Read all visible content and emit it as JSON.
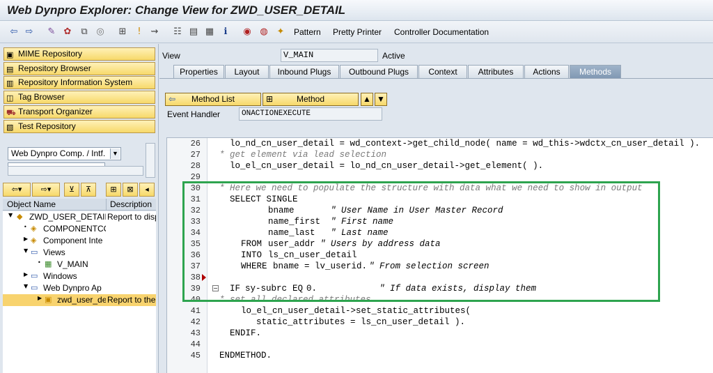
{
  "window": {
    "title": "Web Dynpro Explorer: Change View for ZWD_USER_DETAIL"
  },
  "toolbar": {
    "pattern": "Pattern",
    "pretty_printer": "Pretty Printer",
    "controller_documentation": "Controller Documentation"
  },
  "nav": {
    "mime_repository": "MIME Repository",
    "repository_browser": "Repository Browser",
    "repository_information_system": "Repository Information System",
    "tag_browser": "Tag Browser",
    "transport_organizer": "Transport Organizer",
    "test_repository": "Test Repository"
  },
  "object_selector": {
    "type_value": "Web Dynpro Comp. / Intf."
  },
  "tree": {
    "col_object_name": "Object Name",
    "col_description": "Description",
    "rows": [
      {
        "name": "ZWD_USER_DETAIL",
        "desc": "Report to disp"
      },
      {
        "name": "COMPONENTCO",
        "desc": ""
      },
      {
        "name": "Component Inte",
        "desc": ""
      },
      {
        "name": "Views",
        "desc": ""
      },
      {
        "name": "V_MAIN",
        "desc": ""
      },
      {
        "name": "Windows",
        "desc": ""
      },
      {
        "name": "Web Dynpro Ap",
        "desc": ""
      },
      {
        "name": "zwd_user_de",
        "desc": "Report to the"
      }
    ]
  },
  "view": {
    "label": "View",
    "name": "V_MAIN",
    "status": "Active"
  },
  "tabs": [
    "Properties",
    "Layout",
    "Inbound Plugs",
    "Outbound Plugs",
    "Context",
    "Attributes",
    "Actions",
    "Methods"
  ],
  "method_bar": {
    "method_list": "Method List",
    "method": "Method",
    "event_handler_label": "Event Handler",
    "event_handler_value": "ONACTIONEXECUTE"
  },
  "code": {
    "line_numbers": [
      "26",
      "27",
      "28",
      "29",
      "30",
      "31",
      "32",
      "33",
      "34",
      "35",
      "36",
      "37",
      "38",
      "39",
      "40",
      "41",
      "42",
      "43",
      "44",
      "45"
    ],
    "l26": "lo_nd_cn_user_detail = wd_context->get_child_node( name = wd_this->wdctx_cn_user_detail ).",
    "l27": "* get element via lead selection",
    "l28": "lo_el_cn_user_detail = lo_nd_cn_user_detail->get_element( ).",
    "l30": "* Here we need to populate the structure with data what we need to show in output",
    "l31_kw": "SELECT SINGLE",
    "l32_a": "bname",
    "l32_c": "\" User Name in User Master Record",
    "l33_a": "name_first",
    "l33_c": "\" First name",
    "l34_a": "name_last",
    "l34_c": "\" Last name",
    "l35_kw": "FROM",
    "l35_a": "user_addr",
    "l35_c": "\" Users by address data",
    "l36_kw": "INTO",
    "l36_a": "ls_cn_user_detail",
    "l37_kw": "WHERE",
    "l37_a": "bname = lv_userid.",
    "l37_c": "\" From selection screen",
    "l39_kw": "IF",
    "l39_a": "sy-subrc",
    "l39_kw2": "EQ",
    "l39_b": "0.",
    "l39_c": "\" If data exists, display them",
    "l40": "* set all declared attributes",
    "l41": "lo_el_cn_user_detail->set_static_attributes(",
    "l42": "static_attributes = ls_cn_user_detail ).",
    "l43_kw": "ENDIF.",
    "l45_kw": "ENDMETHOD."
  }
}
